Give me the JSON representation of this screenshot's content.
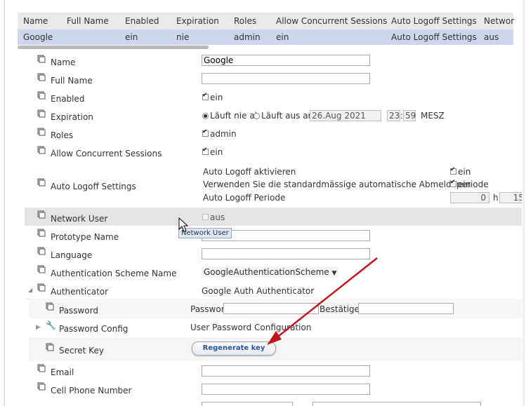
{
  "summary": {
    "headers": [
      "Name",
      "Full Name",
      "Enabled",
      "Expiration",
      "Roles",
      "Allow Concurrent Sessions",
      "Auto Logoff Settings",
      "Networ"
    ],
    "row": [
      "Google",
      "",
      "ein",
      "nie",
      "admin",
      "ein",
      "Auto Logoff Settings",
      "aus"
    ]
  },
  "props": {
    "name": {
      "label": "Name",
      "value": "Google"
    },
    "full_name": {
      "label": "Full Name",
      "value": ""
    },
    "enabled": {
      "label": "Enabled",
      "value": "ein"
    },
    "expiration": {
      "label": "Expiration",
      "never": "Läuft nie ab",
      "expires": "Läuft aus am",
      "date": "26.Aug 2021",
      "hour": "23",
      "minute": "59",
      "tz": "MESZ"
    },
    "roles": {
      "label": "Roles",
      "value": "admin"
    },
    "concurrent": {
      "label": "Allow Concurrent Sessions",
      "value": "ein"
    },
    "auto_logoff": {
      "label": "Auto Logoff Settings",
      "line1": "Auto Logoff aktivieren",
      "line1_val": "ein",
      "line2": "Verwenden Sie die standardmässige automatische Abmeldeperiode",
      "line2_val": "ein",
      "line3": "Auto Logoff Periode",
      "hours": "0",
      "h_unit": "h",
      "minutes": "15"
    },
    "network_user": {
      "label": "Network User",
      "value": "aus",
      "tooltip": "Network User"
    },
    "prototype": {
      "label": "Prototype Name",
      "value": ""
    },
    "language": {
      "label": "Language",
      "value": ""
    },
    "auth_scheme": {
      "label": "Authentication Scheme Name",
      "value": "GoogleAuthenticationScheme"
    },
    "authenticator": {
      "label": "Authenticator",
      "value": "Google Auth Authenticator"
    },
    "password": {
      "label": "Password",
      "pw_label": "Passwort",
      "confirm_label": "Bestätigen"
    },
    "password_config": {
      "label": "Password Config",
      "value": "User Password Configuration"
    },
    "secret_key": {
      "label": "Secret Key",
      "button": "Regenerate key"
    },
    "email": {
      "label": "Email",
      "value": ""
    },
    "cell_phone": {
      "label": "Cell Phone Number",
      "value": ""
    }
  },
  "colors": {
    "arrow": "#c0161b",
    "header_bg": "#e9e9ec",
    "selected_row": "#cdd6ea",
    "button_text": "#2b54a0"
  }
}
